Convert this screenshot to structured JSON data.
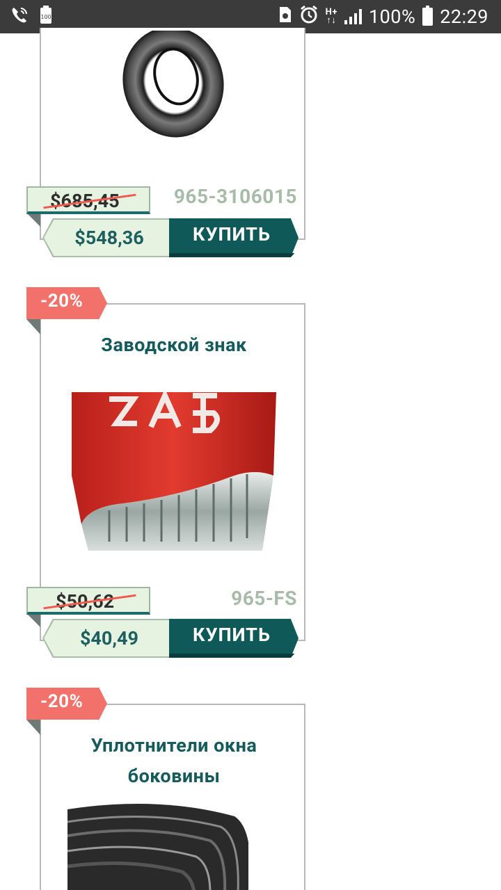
{
  "status_bar": {
    "battery_percent": "100%",
    "time": "22:29",
    "network": "H+",
    "icons": [
      "phone-wifi-icon",
      "battery-saver-icon",
      "sim-icon",
      "alarm-icon",
      "signal-icon",
      "battery-icon"
    ]
  },
  "products": [
    {
      "title": "",
      "sku": "965-3106015",
      "old_price": "$685,45",
      "new_price": "$548,36",
      "buy_label": "КУПИТЬ",
      "image": "tire-icon"
    },
    {
      "badge": "-20%",
      "title": "Заводской знак",
      "sku": "965-FS",
      "old_price": "$50,62",
      "new_price": "$40,49",
      "buy_label": "КУПИТЬ",
      "image": "factory-badge-icon"
    },
    {
      "badge": "-20%",
      "title_line1": "Уплотнители окна",
      "title_line2": "боковины",
      "image": "window-seal-icon"
    }
  ],
  "colors": {
    "status_bar_bg": "#3b3b3b",
    "title_teal": "#155b5b",
    "buy_button": "#0f5959",
    "badge_red": "#f2716a",
    "price_bg": "#e6f3e1",
    "sku_gray": "#a8bba9"
  }
}
